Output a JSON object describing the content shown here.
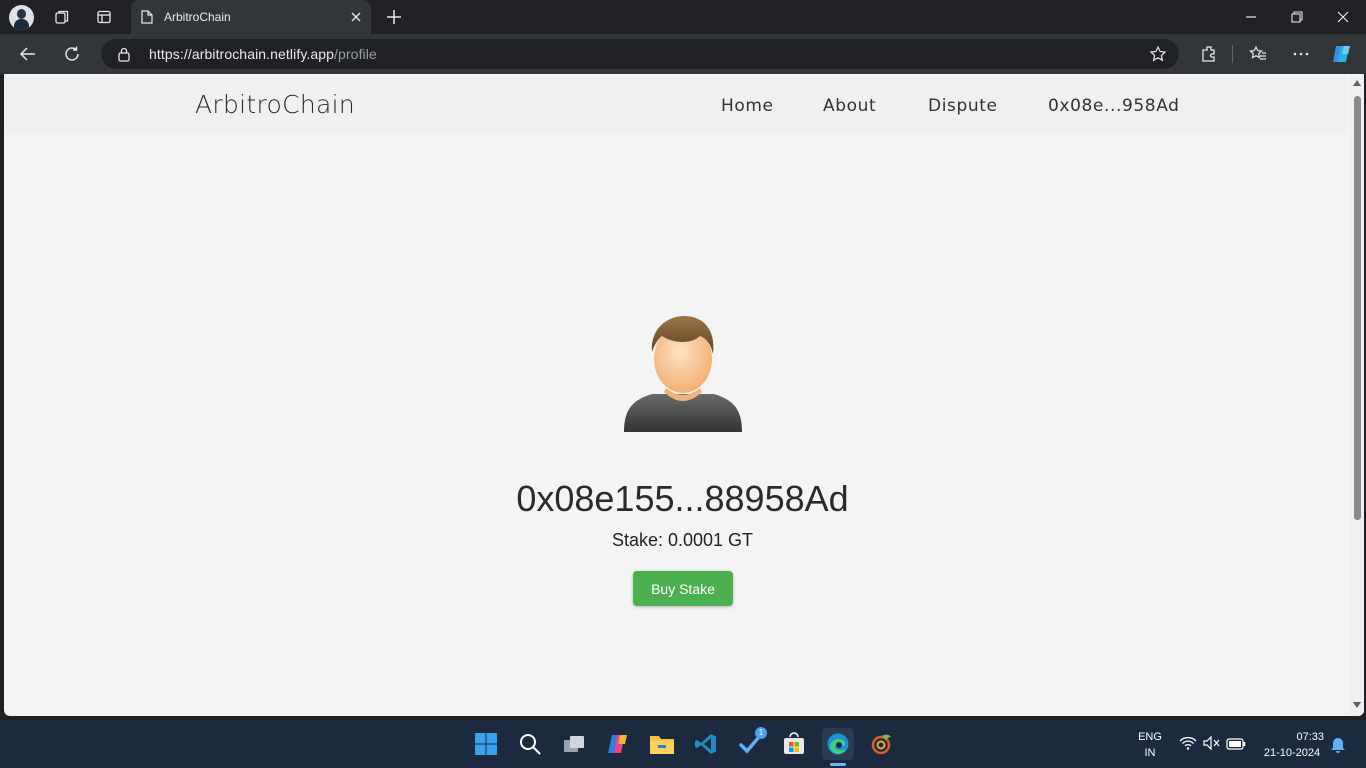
{
  "browser": {
    "tab_title": "ArbitroChain",
    "url_host": "https://arbitrochain.netlify.app",
    "url_path": "/profile"
  },
  "site": {
    "brand": "ArbitroChain",
    "nav": [
      {
        "label": "Home"
      },
      {
        "label": "About"
      },
      {
        "label": "Dispute"
      },
      {
        "label": "0x08e...958Ad"
      }
    ]
  },
  "profile": {
    "address": "0x08e155...88958Ad",
    "stake": "Stake: 0.0001 GT",
    "buy_label": "Buy Stake",
    "accent": "#4caf50"
  },
  "taskbar": {
    "language": "ENG",
    "region": "IN",
    "time": "07:33",
    "date": "21-10-2024",
    "badge_count": "1",
    "icons": [
      "start-icon",
      "search-icon",
      "task-view-icon",
      "copilot-icon",
      "file-explorer-icon",
      "vscode-icon",
      "tasks-icon",
      "store-icon",
      "edge-icon",
      "app-icon"
    ]
  }
}
